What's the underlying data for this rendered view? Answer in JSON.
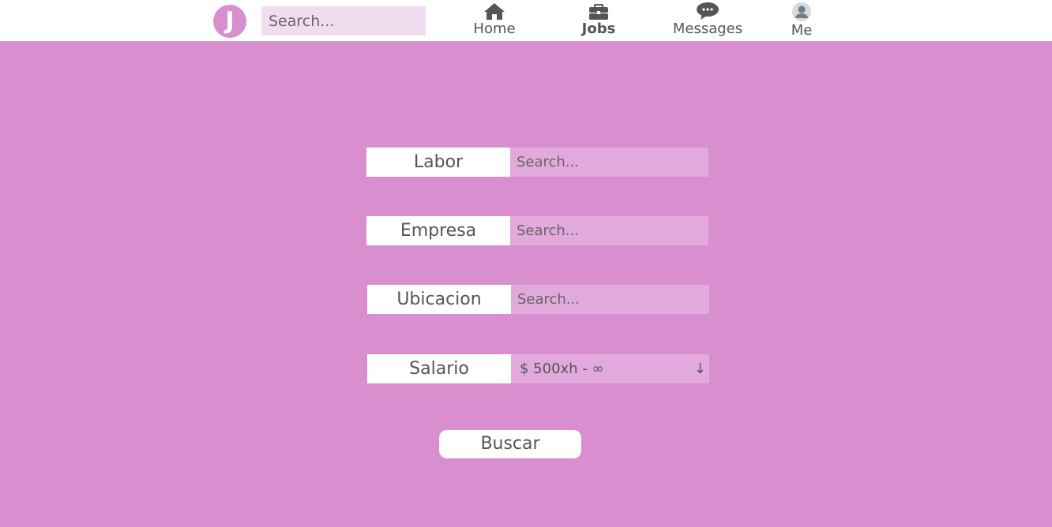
{
  "header": {
    "logo_letter": "J",
    "search_placeholder": "Search...",
    "nav": [
      {
        "label": "Home",
        "icon": "home-icon",
        "active": false
      },
      {
        "label": "Jobs",
        "icon": "briefcase-icon",
        "active": true
      },
      {
        "label": "Messages",
        "icon": "chat-bubble-icon",
        "active": false
      },
      {
        "label": "Me",
        "icon": "avatar-icon",
        "active": false
      }
    ]
  },
  "form": {
    "fields": [
      {
        "label": "Labor",
        "placeholder": "Search..."
      },
      {
        "label": "Empresa",
        "placeholder": "Search..."
      },
      {
        "label": "Ubicacion",
        "placeholder": "Search..."
      }
    ],
    "salary": {
      "label": "Salario",
      "selected": "$ 500xh - ∞",
      "arrow": "↓"
    },
    "submit_label": "Buscar"
  },
  "colors": {
    "background": "#d88ecf",
    "input_bg": "#e1a9dc",
    "top_search_bg": "#f2ddf0",
    "text": "#555555"
  }
}
